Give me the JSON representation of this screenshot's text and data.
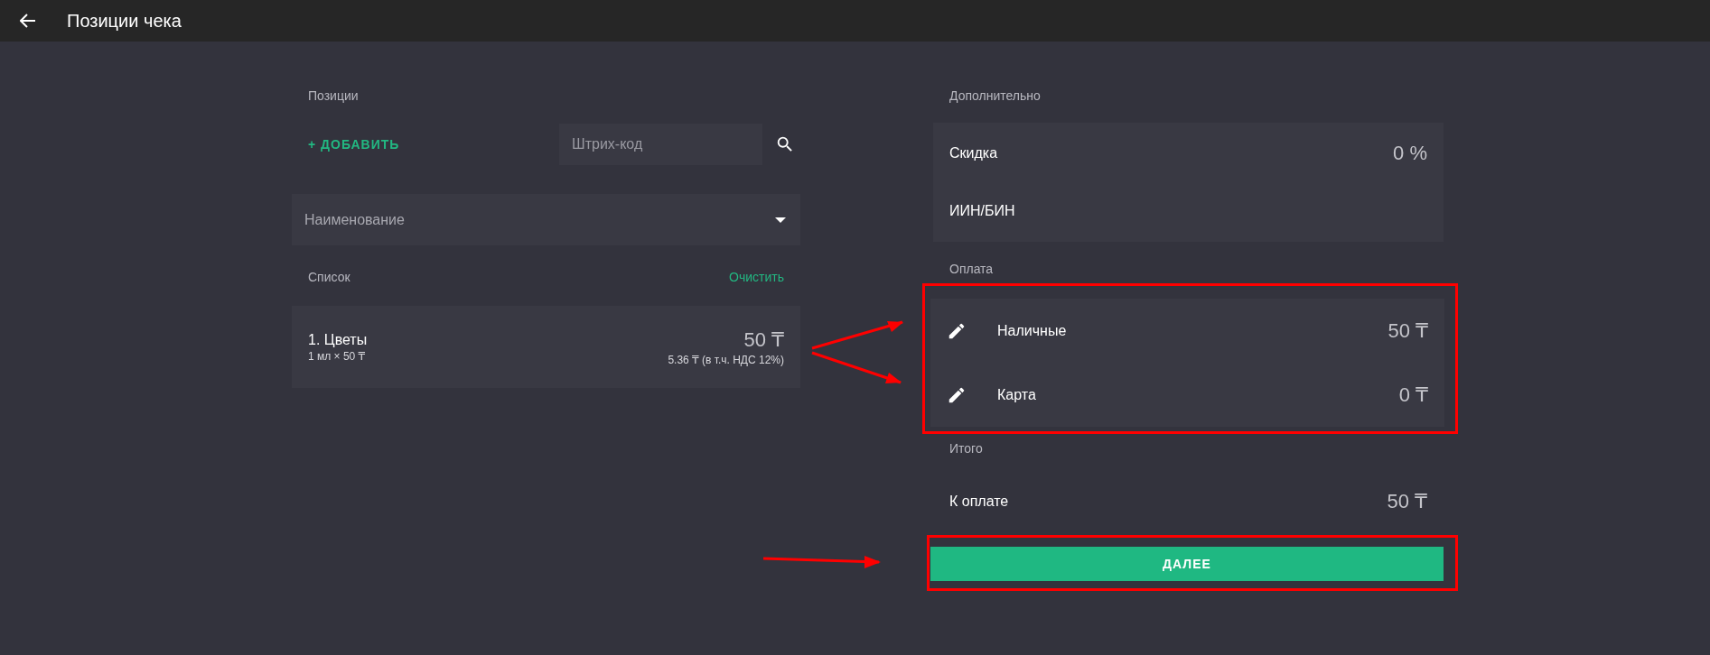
{
  "header": {
    "title": "Позиции чека"
  },
  "positions": {
    "label": "Позиции",
    "add_button": "+ ДОБАВИТЬ",
    "barcode": {
      "placeholder": "Штрих-код"
    },
    "name_select": {
      "placeholder": "Наименование"
    },
    "list_label": "Список",
    "clear_link": "Очистить",
    "items": [
      {
        "title": "1. Цветы",
        "quantity": "1 мл × 50 ₸",
        "price": "50 ₸",
        "tax": "5.36 ₸ (в т.ч. НДС 12%)"
      }
    ]
  },
  "extra": {
    "label": "Дополнительно",
    "rows": [
      {
        "label": "Скидка",
        "value": "0 %"
      },
      {
        "label": "ИИН/БИН"
      }
    ]
  },
  "payment": {
    "label": "Оплата",
    "highlighted": true,
    "methods": [
      {
        "label": "Наличные",
        "amount": "50 ₸"
      },
      {
        "label": "Карта",
        "amount": "0 ₸"
      }
    ]
  },
  "total": {
    "label": "Итого",
    "rows": [
      {
        "label": "К оплате",
        "value": "50 ₸"
      }
    ]
  },
  "next_button": {
    "label": "ДАЛЕЕ",
    "highlighted": true
  }
}
